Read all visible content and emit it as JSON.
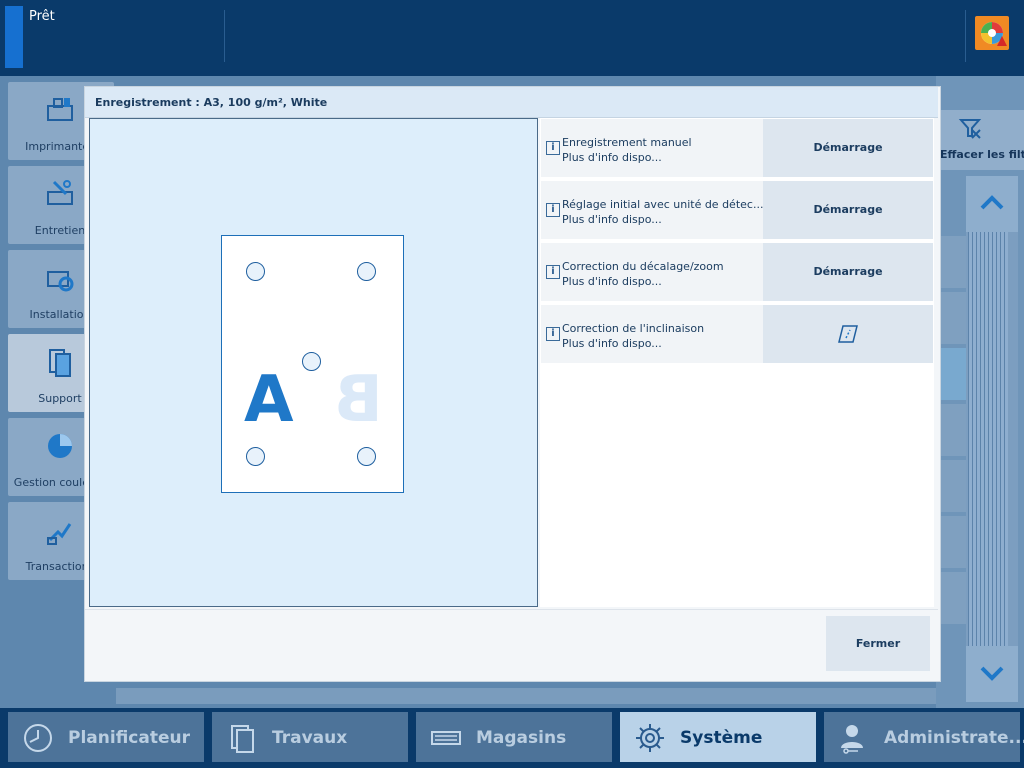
{
  "status": {
    "text": "Prêt"
  },
  "sidebar": {
    "items": [
      {
        "label": "Imprimantes",
        "icon": "printer-icon"
      },
      {
        "label": "Entretien",
        "icon": "maintenance-icon"
      },
      {
        "label": "Installation",
        "icon": "installation-icon"
      },
      {
        "label": "Support",
        "icon": "media-icon",
        "active": true
      },
      {
        "label": "Gestion couleurs",
        "icon": "color-management-icon"
      },
      {
        "label": "Transactions",
        "icon": "transactions-icon"
      }
    ]
  },
  "filter": {
    "label": "Effacer les filt..."
  },
  "dialog": {
    "title": "Enregistrement : A3, 100 g/m², White",
    "preview": {
      "letter_front": "A",
      "letter_back": "B"
    },
    "rows": [
      {
        "name": "Enregistrement manuel",
        "more": "Plus d'info dispo...",
        "action": "Démarrage"
      },
      {
        "name": "Réglage initial avec unité de détec...",
        "more": "Plus d'info dispo...",
        "action": "Démarrage"
      },
      {
        "name": "Correction du décalage/zoom",
        "more": "Plus d'info dispo...",
        "action": "Démarrage"
      },
      {
        "name": "Correction de l'inclinaison",
        "more": "Plus d'info dispo...",
        "action": "",
        "action_icon": "skew-icon"
      }
    ],
    "info_glyph": "i",
    "close_label": "Fermer"
  },
  "nav": {
    "tabs": [
      {
        "label": "Planificateur",
        "icon": "clock-icon"
      },
      {
        "label": "Travaux",
        "icon": "jobs-icon"
      },
      {
        "label": "Magasins",
        "icon": "trays-icon"
      },
      {
        "label": "Système",
        "icon": "gear-icon",
        "active": true
      },
      {
        "label": "Administrate...",
        "icon": "admin-icon"
      }
    ]
  },
  "colors": {
    "accent": "#1670d0",
    "nav_bg": "#0a3a6a",
    "active_tab": "#b9d2e8",
    "preview_bg": "#ddeefb",
    "alert": "#f08a24"
  }
}
